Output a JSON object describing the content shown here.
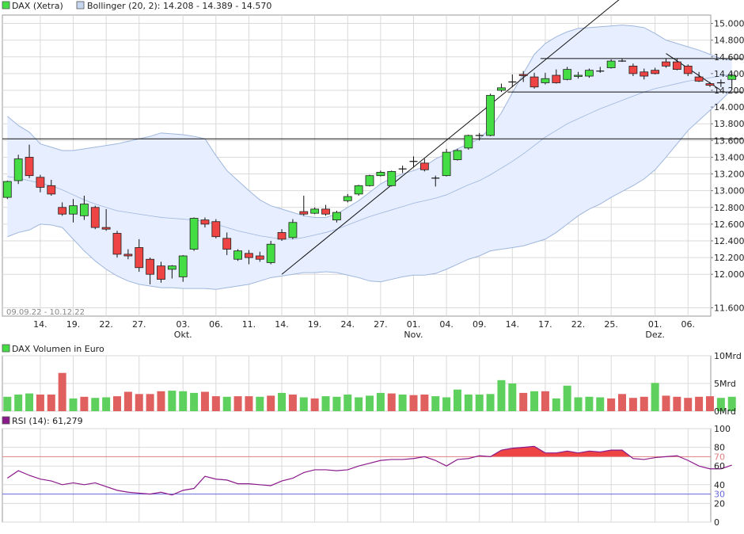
{
  "chart_data": {
    "type": "candlestick",
    "legend": {
      "price": "DAX (Xetra)",
      "bollinger": "Bollinger (20, 2): 14.208 - 14.389 - 14.570",
      "volume": "DAX Volumen in Euro",
      "rsi": "RSI (14): 61,279"
    },
    "date_range": "09.09.22 - 10.12.22",
    "colors": {
      "up": "#44dd44",
      "down": "#ee4444",
      "band_fill": "#e6eeff",
      "band_line": "#9fb6dd",
      "vol_up": "#5ed05e",
      "vol_down": "#e06060",
      "rsi_line": "#8b1a8b",
      "rsi_over": "#ee4444",
      "rsi_70": "#e08080",
      "rsi_30": "#6666dd"
    },
    "price_axis": {
      "min": 11500,
      "max": 15100,
      "ticks": [
        11600,
        12000,
        12200,
        12400,
        12600,
        12800,
        13000,
        13200,
        13400,
        13600,
        13800,
        14000,
        14200,
        14400,
        14600,
        14800,
        15000
      ],
      "tick_labels": [
        "11.600",
        "12.000",
        "12.200",
        "12.400",
        "12.600",
        "12.800",
        "13.000",
        "13.200",
        "13.400",
        "13.600",
        "13.800",
        "14.000",
        "14.200",
        "14.400",
        "14.600",
        "14.800",
        "15.000"
      ]
    },
    "x_ticks": [
      {
        "i": 3,
        "label": "14."
      },
      {
        "i": 6,
        "label": "19."
      },
      {
        "i": 9,
        "label": "22."
      },
      {
        "i": 12,
        "label": "27."
      },
      {
        "i": 16,
        "label": "03.",
        "sub": "Okt."
      },
      {
        "i": 19,
        "label": "06."
      },
      {
        "i": 22,
        "label": "11."
      },
      {
        "i": 25,
        "label": "14."
      },
      {
        "i": 28,
        "label": "19."
      },
      {
        "i": 31,
        "label": "24."
      },
      {
        "i": 34,
        "label": "27."
      },
      {
        "i": 37,
        "label": "01.",
        "sub": "Nov."
      },
      {
        "i": 40,
        "label": "04."
      },
      {
        "i": 43,
        "label": "09."
      },
      {
        "i": 46,
        "label": "14."
      },
      {
        "i": 49,
        "label": "17."
      },
      {
        "i": 52,
        "label": "22."
      },
      {
        "i": 55,
        "label": "25."
      },
      {
        "i": 59,
        "label": "01.",
        "sub": "Dez."
      },
      {
        "i": 62,
        "label": "06."
      }
    ],
    "candles": [
      {
        "o": 12920,
        "h": 13120,
        "l": 12900,
        "c": 13110
      },
      {
        "o": 13120,
        "h": 13430,
        "l": 13080,
        "c": 13380
      },
      {
        "o": 13400,
        "h": 13550,
        "l": 13150,
        "c": 13180
      },
      {
        "o": 13160,
        "h": 13190,
        "l": 12980,
        "c": 13040
      },
      {
        "o": 13060,
        "h": 13130,
        "l": 12940,
        "c": 12960
      },
      {
        "o": 12800,
        "h": 12860,
        "l": 12700,
        "c": 12720
      },
      {
        "o": 12720,
        "h": 12900,
        "l": 12620,
        "c": 12820
      },
      {
        "o": 12700,
        "h": 12940,
        "l": 12650,
        "c": 12840
      },
      {
        "o": 12800,
        "h": 12820,
        "l": 12540,
        "c": 12560
      },
      {
        "o": 12560,
        "h": 12780,
        "l": 12520,
        "c": 12540
      },
      {
        "o": 12490,
        "h": 12520,
        "l": 12200,
        "c": 12240
      },
      {
        "o": 12240,
        "h": 12300,
        "l": 12180,
        "c": 12220
      },
      {
        "o": 12320,
        "h": 12420,
        "l": 12030,
        "c": 12080
      },
      {
        "o": 12180,
        "h": 12200,
        "l": 11880,
        "c": 12000
      },
      {
        "o": 12100,
        "h": 12150,
        "l": 11900,
        "c": 11940
      },
      {
        "o": 12060,
        "h": 12110,
        "l": 11950,
        "c": 12100
      },
      {
        "o": 11970,
        "h": 12230,
        "l": 11910,
        "c": 12220
      },
      {
        "o": 12300,
        "h": 12680,
        "l": 12280,
        "c": 12670
      },
      {
        "o": 12650,
        "h": 12680,
        "l": 12560,
        "c": 12600
      },
      {
        "o": 12630,
        "h": 12660,
        "l": 12430,
        "c": 12450
      },
      {
        "o": 12430,
        "h": 12500,
        "l": 12230,
        "c": 12300
      },
      {
        "o": 12180,
        "h": 12300,
        "l": 12160,
        "c": 12280
      },
      {
        "o": 12250,
        "h": 12290,
        "l": 12120,
        "c": 12200
      },
      {
        "o": 12220,
        "h": 12270,
        "l": 12150,
        "c": 12180
      },
      {
        "o": 12140,
        "h": 12400,
        "l": 12120,
        "c": 12360
      },
      {
        "o": 12500,
        "h": 12540,
        "l": 12400,
        "c": 12420
      },
      {
        "o": 12440,
        "h": 12660,
        "l": 12420,
        "c": 12620
      },
      {
        "o": 12750,
        "h": 12940,
        "l": 12700,
        "c": 12720
      },
      {
        "o": 12730,
        "h": 12800,
        "l": 12720,
        "c": 12780
      },
      {
        "o": 12780,
        "h": 12830,
        "l": 12700,
        "c": 12720
      },
      {
        "o": 12650,
        "h": 12760,
        "l": 12620,
        "c": 12740
      },
      {
        "o": 12880,
        "h": 12960,
        "l": 12860,
        "c": 12930
      },
      {
        "o": 12960,
        "h": 13070,
        "l": 12940,
        "c": 13060
      },
      {
        "o": 13060,
        "h": 13190,
        "l": 13050,
        "c": 13180
      },
      {
        "o": 13180,
        "h": 13240,
        "l": 13170,
        "c": 13220
      },
      {
        "o": 13060,
        "h": 13240,
        "l": 13050,
        "c": 13230
      },
      {
        "o": 13260,
        "h": 13300,
        "l": 13210,
        "c": 13260
      },
      {
        "o": 13350,
        "h": 13410,
        "l": 13280,
        "c": 13350
      },
      {
        "o": 13330,
        "h": 13380,
        "l": 13230,
        "c": 13250
      },
      {
        "o": 13150,
        "h": 13180,
        "l": 13050,
        "c": 13150
      },
      {
        "o": 13180,
        "h": 13500,
        "l": 13170,
        "c": 13460
      },
      {
        "o": 13370,
        "h": 13500,
        "l": 13360,
        "c": 13480
      },
      {
        "o": 13510,
        "h": 13670,
        "l": 13490,
        "c": 13660
      },
      {
        "o": 13660,
        "h": 13690,
        "l": 13600,
        "c": 13660
      },
      {
        "o": 13660,
        "h": 14160,
        "l": 13650,
        "c": 14140
      },
      {
        "o": 14200,
        "h": 14280,
        "l": 14180,
        "c": 14230
      },
      {
        "o": 14300,
        "h": 14390,
        "l": 14240,
        "c": 14300
      },
      {
        "o": 14390,
        "h": 14430,
        "l": 14300,
        "c": 14380
      },
      {
        "o": 14360,
        "h": 14410,
        "l": 14220,
        "c": 14240
      },
      {
        "o": 14290,
        "h": 14410,
        "l": 14270,
        "c": 14340
      },
      {
        "o": 14380,
        "h": 14450,
        "l": 14280,
        "c": 14290
      },
      {
        "o": 14330,
        "h": 14480,
        "l": 14320,
        "c": 14450
      },
      {
        "o": 14370,
        "h": 14420,
        "l": 14340,
        "c": 14380
      },
      {
        "o": 14370,
        "h": 14460,
        "l": 14350,
        "c": 14440
      },
      {
        "o": 14430,
        "h": 14480,
        "l": 14410,
        "c": 14430
      },
      {
        "o": 14470,
        "h": 14570,
        "l": 14460,
        "c": 14550
      },
      {
        "o": 14550,
        "h": 14580,
        "l": 14540,
        "c": 14550
      },
      {
        "o": 14490,
        "h": 14520,
        "l": 14370,
        "c": 14400
      },
      {
        "o": 14420,
        "h": 14460,
        "l": 14330,
        "c": 14370
      },
      {
        "o": 14440,
        "h": 14470,
        "l": 14390,
        "c": 14400
      },
      {
        "o": 14540,
        "h": 14580,
        "l": 14470,
        "c": 14490
      },
      {
        "o": 14540,
        "h": 14580,
        "l": 14440,
        "c": 14450
      },
      {
        "o": 14490,
        "h": 14510,
        "l": 14370,
        "c": 14400
      },
      {
        "o": 14360,
        "h": 14420,
        "l": 14300,
        "c": 14310
      },
      {
        "o": 14280,
        "h": 14300,
        "l": 14240,
        "c": 14260
      },
      {
        "o": 14290,
        "h": 14330,
        "l": 14240,
        "c": 14290
      },
      {
        "o": 14330,
        "h": 14420,
        "l": 14210,
        "c": 14380
      }
    ],
    "bollinger_upper": [
      13890,
      13780,
      13700,
      13560,
      13520,
      13480,
      13480,
      13500,
      13520,
      13540,
      13560,
      13590,
      13620,
      13650,
      13690,
      13680,
      13670,
      13650,
      13620,
      13420,
      13240,
      13120,
      13000,
      12890,
      12820,
      12780,
      12740,
      12700,
      12680,
      12680,
      12720,
      12800,
      12880,
      12980,
      13080,
      13150,
      13200,
      13240,
      13290,
      13380,
      13440,
      13500,
      13560,
      13620,
      13750,
      13930,
      14170,
      14400,
      14630,
      14760,
      14840,
      14900,
      14940,
      14950,
      14960,
      14970,
      14980,
      14970,
      14950,
      14880,
      14800,
      14760,
      14720,
      14680,
      14630,
      14580,
      14560
    ],
    "bollinger_mid": [
      13170,
      13150,
      13120,
      13090,
      13060,
      13010,
      12950,
      12890,
      12840,
      12800,
      12760,
      12740,
      12720,
      12700,
      12680,
      12670,
      12660,
      12650,
      12630,
      12600,
      12560,
      12520,
      12490,
      12460,
      12440,
      12420,
      12420,
      12440,
      12470,
      12500,
      12540,
      12590,
      12640,
      12690,
      12730,
      12770,
      12810,
      12850,
      12880,
      12910,
      12950,
      13010,
      13070,
      13120,
      13190,
      13270,
      13350,
      13440,
      13540,
      13640,
      13720,
      13800,
      13860,
      13920,
      13980,
      14030,
      14080,
      14130,
      14180,
      14220,
      14250,
      14280,
      14310,
      14330,
      14350,
      14370,
      14390
    ],
    "bollinger_lower": [
      12450,
      12500,
      12530,
      12600,
      12590,
      12560,
      12420,
      12280,
      12160,
      12060,
      11980,
      11920,
      11880,
      11860,
      11840,
      11840,
      11830,
      11830,
      11830,
      11820,
      11840,
      11860,
      11880,
      11920,
      11960,
      11980,
      12000,
      12020,
      12020,
      12030,
      12020,
      11990,
      11960,
      11920,
      11910,
      11940,
      11970,
      11990,
      11990,
      12010,
      12060,
      12120,
      12180,
      12220,
      12280,
      12300,
      12320,
      12340,
      12380,
      12420,
      12500,
      12600,
      12700,
      12780,
      12840,
      12920,
      12990,
      13060,
      13140,
      13250,
      13400,
      13560,
      13720,
      13840,
      13960,
      14080,
      14208
    ],
    "lines": [
      {
        "type": "hline",
        "y": 13620
      },
      {
        "type": "hline",
        "y": 14580,
        "from": 49
      },
      {
        "type": "hline",
        "y": 14180,
        "from": 46
      },
      {
        "type": "trend",
        "i1": 25,
        "v1": 12000,
        "i2": 57,
        "v2": 15420
      },
      {
        "type": "trend",
        "i1": 60,
        "v1": 14640,
        "i2": 65,
        "v2": 14200
      }
    ],
    "volume_axis": {
      "max": 10,
      "ticks": [
        0,
        5,
        10
      ],
      "tick_labels": [
        "0Mrd",
        "5Mrd",
        "10Mrd"
      ]
    },
    "volume": [
      2.6,
      3.0,
      3.2,
      3.0,
      3.0,
      6.9,
      2.3,
      2.6,
      2.4,
      2.5,
      2.7,
      3.5,
      3.1,
      3.1,
      3.6,
      3.7,
      3.6,
      3.3,
      3.5,
      2.7,
      2.6,
      2.7,
      2.7,
      2.6,
      2.8,
      3.3,
      3.0,
      2.5,
      2.3,
      2.7,
      2.6,
      3.0,
      2.5,
      2.8,
      3.3,
      3.2,
      3.0,
      2.9,
      3.0,
      2.7,
      2.5,
      3.9,
      3.0,
      3.0,
      3.1,
      5.6,
      5.0,
      3.3,
      3.6,
      3.6,
      2.3,
      4.6,
      2.5,
      2.6,
      2.5,
      2.3,
      3.1,
      2.4,
      2.6,
      5.1,
      2.8,
      2.6,
      2.4,
      2.6,
      2.7,
      2.4,
      2.6
    ],
    "volume_dir": [
      1,
      1,
      1,
      0,
      0,
      0,
      1,
      0,
      1,
      1,
      0,
      0,
      0,
      0,
      0,
      1,
      1,
      1,
      0,
      0,
      1,
      0,
      0,
      1,
      0,
      1,
      0,
      1,
      0,
      1,
      1,
      1,
      1,
      1,
      1,
      0,
      1,
      0,
      0,
      1,
      1,
      1,
      1,
      1,
      1,
      1,
      1,
      0,
      1,
      0,
      1,
      1,
      1,
      1,
      1,
      0,
      0,
      0,
      0,
      1,
      0,
      0,
      0,
      0,
      0,
      1,
      1
    ],
    "rsi_axis": {
      "min": 0,
      "max": 100,
      "ticks": [
        0,
        20,
        40,
        60,
        80,
        100
      ],
      "tick_labels": [
        "0",
        "20",
        "40",
        "60",
        "80",
        "100"
      ],
      "levels": [
        70,
        30
      ],
      "level_labels": [
        "70",
        "30"
      ]
    },
    "rsi": [
      47,
      55,
      50,
      46,
      44,
      40,
      42,
      40,
      42,
      38,
      34,
      32,
      31,
      30,
      32,
      29,
      34,
      36,
      49,
      46,
      45,
      41,
      41,
      40,
      39,
      44,
      47,
      53,
      56,
      56,
      55,
      56,
      60,
      63,
      66,
      67,
      67,
      68,
      70,
      66,
      60,
      67,
      68,
      71,
      70,
      77,
      79,
      80,
      81,
      74,
      74,
      76,
      74,
      76,
      75,
      77,
      77,
      68,
      67,
      69,
      70,
      71,
      66,
      60,
      57,
      57,
      61
    ]
  }
}
